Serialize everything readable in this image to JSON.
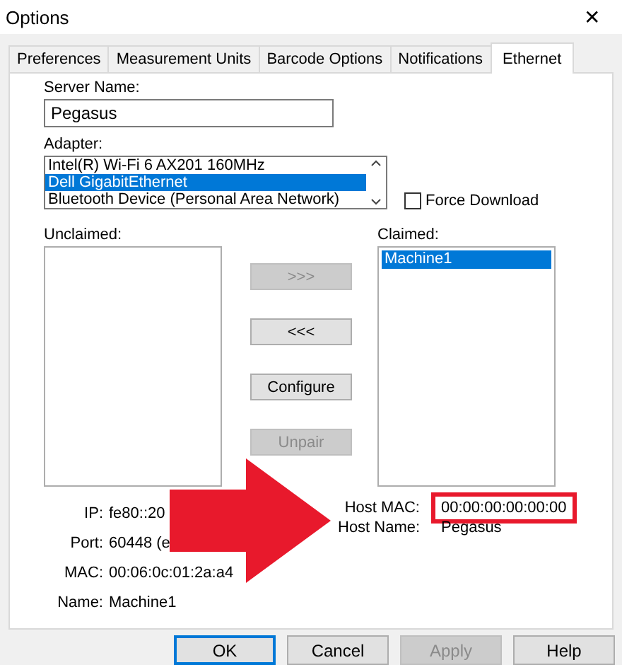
{
  "window": {
    "title": "Options",
    "close": "✕"
  },
  "tabs": [
    {
      "label": "Preferences",
      "selected": false
    },
    {
      "label": "Measurement Units",
      "selected": false
    },
    {
      "label": "Barcode Options",
      "selected": false
    },
    {
      "label": "Notifications",
      "selected": false
    },
    {
      "label": "Ethernet",
      "selected": true
    }
  ],
  "server_name": {
    "label": "Server Name:",
    "value": "Pegasus"
  },
  "adapter": {
    "label": "Adapter:",
    "items": [
      {
        "label": "Intel(R) Wi-Fi 6 AX201 160MHz",
        "selected": false
      },
      {
        "label": "Dell GigabitEthernet",
        "selected": true
      },
      {
        "label": "Bluetooth Device (Personal Area Network)",
        "selected": false
      }
    ]
  },
  "force_download": {
    "label": "Force Download",
    "checked": false
  },
  "unclaimed": {
    "label": "Unclaimed:"
  },
  "claimed": {
    "label": "Claimed:",
    "items": [
      {
        "label": "Machine1",
        "selected": true
      }
    ]
  },
  "transfer_buttons": [
    {
      "label": ">>>",
      "disabled": true
    },
    {
      "label": "<<<",
      "disabled": false
    },
    {
      "label": "Configure",
      "disabled": false
    },
    {
      "label": "Unpair",
      "disabled": true
    }
  ],
  "device_info": [
    {
      "label": "IP:",
      "value": "fe80::20"
    },
    {
      "label": "Port:",
      "value": "60448 (e"
    },
    {
      "label": "MAC:",
      "value": "00:06:0c:01:2a:a4"
    },
    {
      "label": "Name:",
      "value": "Machine1"
    }
  ],
  "host_info": [
    {
      "label": "Host MAC:",
      "value": "00:00:00:00:00:00",
      "highlighted": true
    },
    {
      "label": "Host Name:",
      "value": "Pegasus",
      "highlighted": false
    }
  ],
  "buttons": [
    {
      "label": "OK",
      "disabled": false,
      "default": true
    },
    {
      "label": "Cancel",
      "disabled": false,
      "default": false
    },
    {
      "label": "Apply",
      "disabled": true,
      "default": false
    },
    {
      "label": "Help",
      "disabled": false,
      "default": false
    }
  ]
}
